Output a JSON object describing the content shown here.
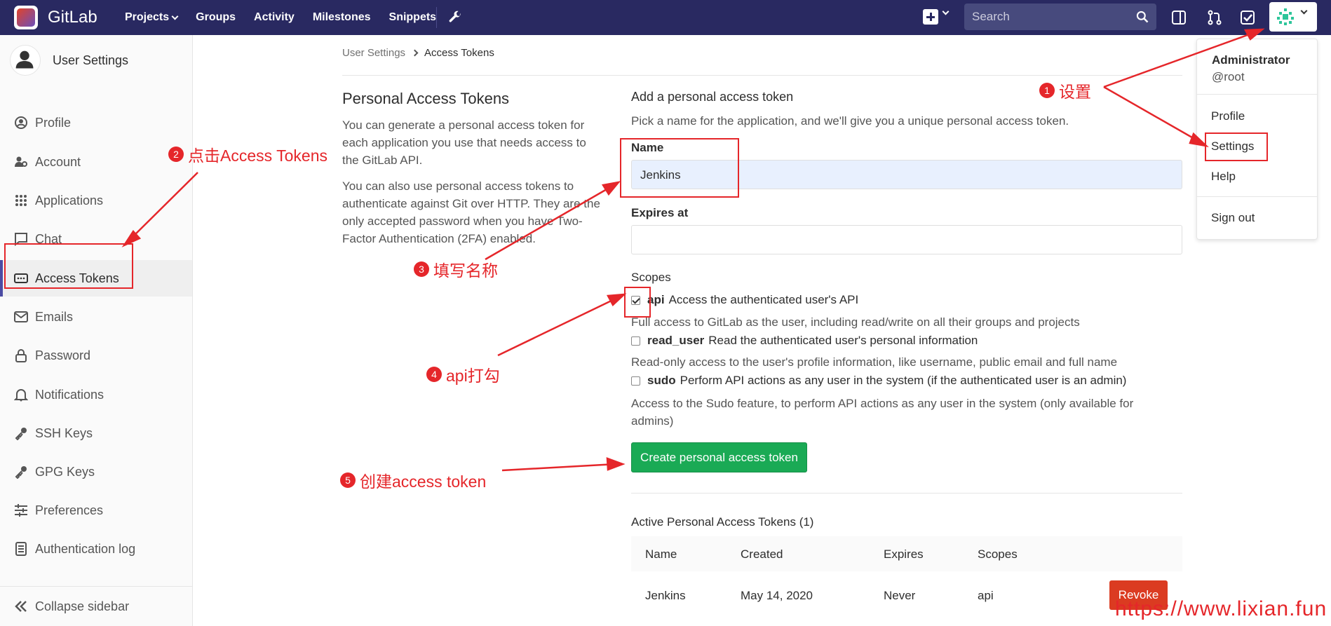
{
  "topnav": {
    "brand": "GitLab",
    "links": [
      "Projects",
      "Groups",
      "Activity",
      "Milestones",
      "Snippets"
    ],
    "search_placeholder": "Search"
  },
  "sidebar": {
    "title": "User Settings",
    "items": [
      {
        "label": "Profile",
        "icon": "profile-icon"
      },
      {
        "label": "Account",
        "icon": "account-icon"
      },
      {
        "label": "Applications",
        "icon": "applications-icon"
      },
      {
        "label": "Chat",
        "icon": "chat-icon"
      },
      {
        "label": "Access Tokens",
        "icon": "access-tokens-icon",
        "active": true
      },
      {
        "label": "Emails",
        "icon": "email-icon"
      },
      {
        "label": "Password",
        "icon": "lock-icon"
      },
      {
        "label": "Notifications",
        "icon": "bell-icon"
      },
      {
        "label": "SSH Keys",
        "icon": "key-icon"
      },
      {
        "label": "GPG Keys",
        "icon": "key-icon"
      },
      {
        "label": "Preferences",
        "icon": "sliders-icon"
      },
      {
        "label": "Authentication log",
        "icon": "log-icon"
      }
    ],
    "collapse_label": "Collapse sidebar"
  },
  "breadcrumb": {
    "parent": "User Settings",
    "current": "Access Tokens"
  },
  "intro": {
    "title": "Personal Access Tokens",
    "p1": [
      "You can generate a personal access token for",
      "each application you use that needs access to",
      "the GitLab API."
    ],
    "p2": [
      "You can also use personal access tokens to",
      "authenticate against Git over HTTP. They are the",
      "only accepted password when you have Two-",
      "Factor Authentication (2FA) enabled."
    ]
  },
  "form": {
    "heading": "Add a personal access token",
    "subtitle": "Pick a name for the application, and we'll give you a unique personal access token.",
    "name_label": "Name",
    "name_value": "Jenkins",
    "expires_label": "Expires at",
    "expires_value": "",
    "scopes_label": "Scopes",
    "scopes": [
      {
        "name": "api",
        "desc": "Access the authenticated user's API",
        "help": "Full access to GitLab as the user, including read/write on all their groups and projects",
        "checked": true
      },
      {
        "name": "read_user",
        "desc": "Read the authenticated user's personal information",
        "help": "Read-only access to the user's profile information, like username, public email and full name",
        "checked": false
      },
      {
        "name": "sudo",
        "desc": "Perform API actions as any user in the system (if the authenticated user is an admin)",
        "help": [
          "Access to the Sudo feature, to perform API actions as any user in the system (only available for",
          "admins)"
        ],
        "checked": false
      }
    ],
    "create_label": "Create personal access token"
  },
  "active_tokens": {
    "heading": "Active Personal Access Tokens (1)",
    "columns": [
      "Name",
      "Created",
      "Expires",
      "Scopes"
    ],
    "rows": [
      {
        "name": "Jenkins",
        "created": "May 14, 2020",
        "expires": "Never",
        "scopes": "api"
      }
    ],
    "revoke_label": "Revoke"
  },
  "user_menu": {
    "name": "Administrator",
    "username": "@root",
    "items": [
      "Profile",
      "Settings",
      "Help",
      "Sign out"
    ]
  },
  "annotations": {
    "a1": {
      "num": "1",
      "text": "设置"
    },
    "a2": {
      "num": "2",
      "text": "点击Access Tokens"
    },
    "a3": {
      "num": "3",
      "text": "填写名称"
    },
    "a4": {
      "num": "4",
      "text": "api打勾"
    },
    "a5": {
      "num": "5",
      "text": "创建access token"
    },
    "watermark": "https://www.lixian.fun",
    "color": "#e5262a"
  },
  "colors": {
    "navbar": "#292961",
    "create": "#1aaa55",
    "revoke": "#db3b21",
    "active_bar": "#4b4ba3"
  }
}
